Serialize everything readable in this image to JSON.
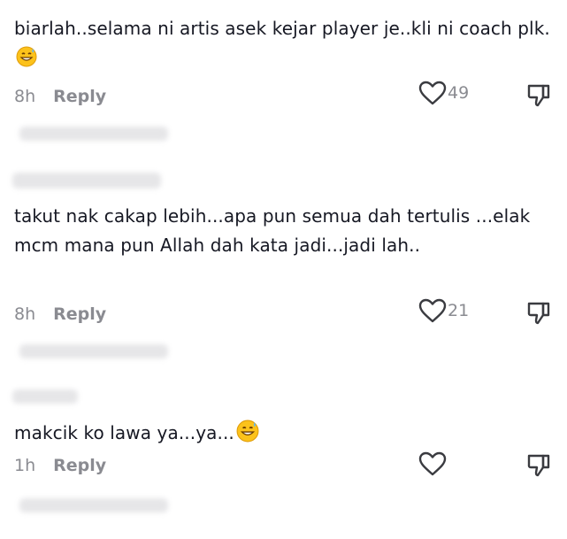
{
  "comments": [
    {
      "text": "biarlah..selama ni artis asek kejar player je..kli ni coach plk.",
      "emoji": "grinning-sweat-emoji",
      "time": "8h",
      "reply_label": "Reply",
      "likes": "49"
    },
    {
      "text": "takut nak cakap lebih...apa pun semua dah tertulis ...elak mcm mana pun Allah dah kata jadi...jadi lah..",
      "time": "8h",
      "reply_label": "Reply",
      "likes": "21"
    },
    {
      "text": "makcik ko lawa ya...ya...",
      "emoji": "grinning-sweat-emoji",
      "time": "1h",
      "reply_label": "Reply",
      "likes": ""
    }
  ],
  "colors": {
    "text": "#161823",
    "meta": "#8a8b91",
    "blur": "#e6e6e8"
  },
  "icons": {
    "like": "heart-outline-icon",
    "dislike": "thumbs-down-outline-icon"
  }
}
